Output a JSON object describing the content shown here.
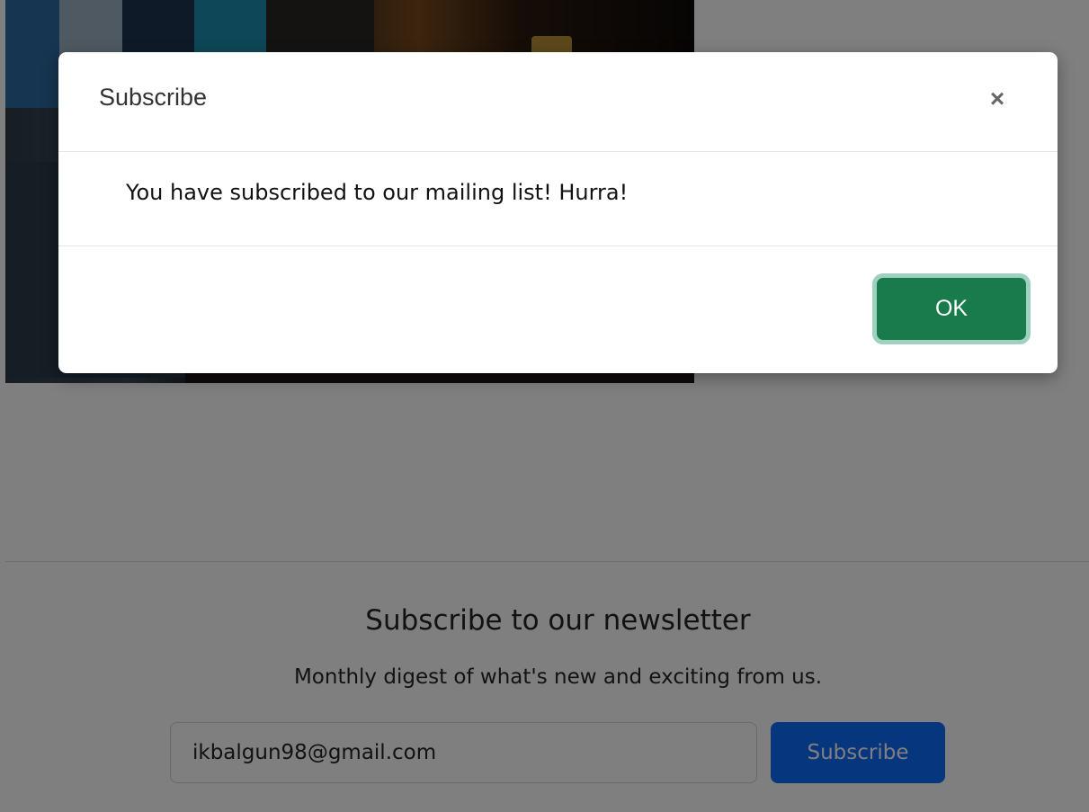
{
  "newsletter": {
    "heading": "Subscribe to our newsletter",
    "subheading": "Monthly digest of what's new and exciting from us.",
    "email_value": "ikbalgun98@gmail.com",
    "subscribe_label": "Subscribe"
  },
  "modal": {
    "title": "Subscribe",
    "close_label": "×",
    "message": "You have subscribed to our mailing list! Hurra!",
    "ok_label": "OK"
  },
  "colors": {
    "primary": "#0d6efd",
    "ok_button": "#197a4c",
    "ok_focus_ring": "#9fd1bf",
    "backdrop": "rgba(0,0,0,0.5)"
  }
}
